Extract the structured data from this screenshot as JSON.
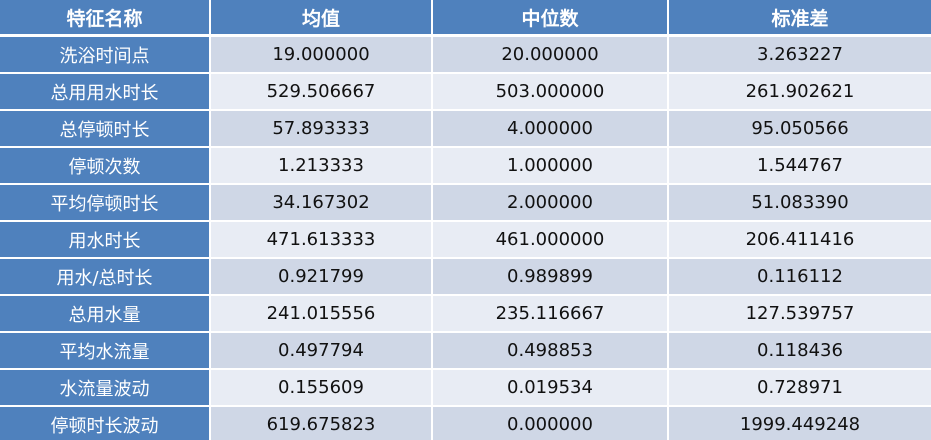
{
  "table": {
    "headers": [
      "特征名称",
      "均值",
      "中位数",
      "标准差"
    ],
    "rows": [
      [
        "洗浴时间点",
        "19.000000",
        "20.000000",
        "3.263227"
      ],
      [
        "总用用水时长",
        "529.506667",
        "503.000000",
        "261.902621"
      ],
      [
        "总停顿时长",
        "57.893333",
        "4.000000",
        "95.050566"
      ],
      [
        "停顿次数",
        "1.213333",
        "1.000000",
        "1.544767"
      ],
      [
        "平均停顿时长",
        "34.167302",
        "2.000000",
        "51.083390"
      ],
      [
        "用水时长",
        "471.613333",
        "461.000000",
        "206.411416"
      ],
      [
        "用水/总时长",
        "0.921799",
        "0.989899",
        "0.116112"
      ],
      [
        "总用水量",
        "241.015556",
        "235.116667",
        "127.539757"
      ],
      [
        "平均水流量",
        "0.497794",
        "0.498853",
        "0.118436"
      ],
      [
        "水流量波动",
        "0.155609",
        "0.019534",
        "0.728971"
      ],
      [
        "停顿时长波动",
        "619.675823",
        "0.000000",
        "1999.449248"
      ]
    ]
  },
  "colors": {
    "header_bg": "#4f81bd",
    "row_odd": "#cfd7e6",
    "row_even": "#e8ecf4"
  }
}
